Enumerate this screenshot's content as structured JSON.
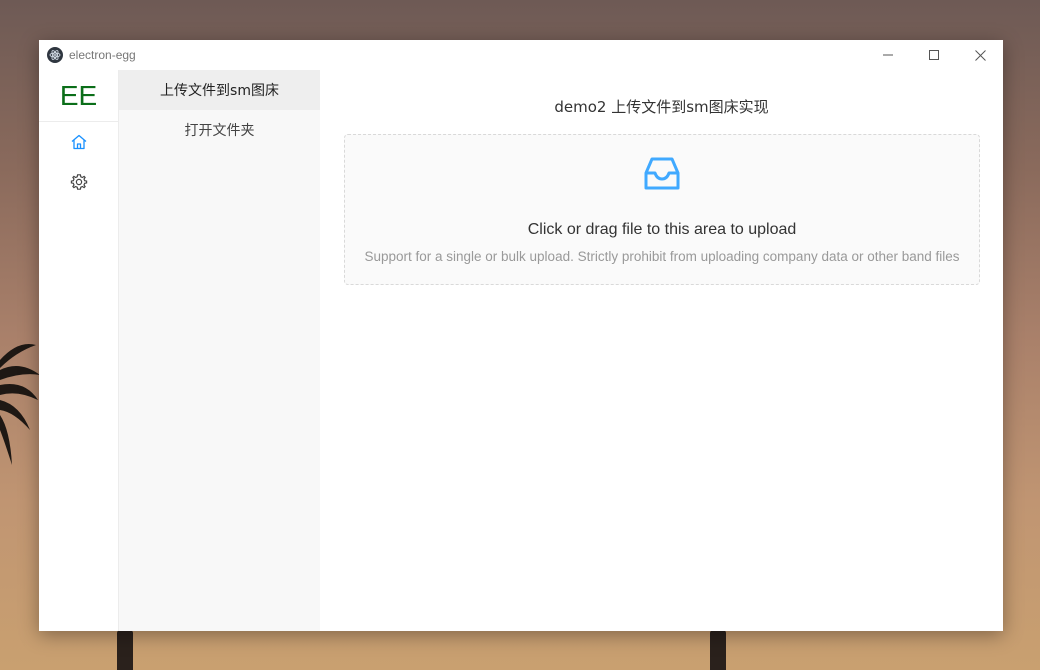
{
  "window": {
    "title": "electron-egg",
    "controls": {
      "minimize_icon": "minimize-icon",
      "maximize_icon": "maximize-icon",
      "close_icon": "close-icon"
    }
  },
  "rail": {
    "logo": "EE",
    "logo_color": "#0b6e19",
    "items": [
      {
        "icon": "home-icon",
        "active": true
      },
      {
        "icon": "gear-icon",
        "active": false
      }
    ]
  },
  "submenu": {
    "items": [
      {
        "label": "上传文件到sm图床",
        "active": true
      },
      {
        "label": "打开文件夹",
        "active": false
      }
    ]
  },
  "main": {
    "title": "demo2 上传文件到sm图床实现",
    "upload": {
      "icon": "inbox-icon",
      "text": "Click or drag file to this area to upload",
      "hint": "Support for a single or bulk upload. Strictly prohibit from uploading company data or other band files"
    }
  },
  "colors": {
    "accent": "#1890ff",
    "logo": "#0b6e19"
  }
}
